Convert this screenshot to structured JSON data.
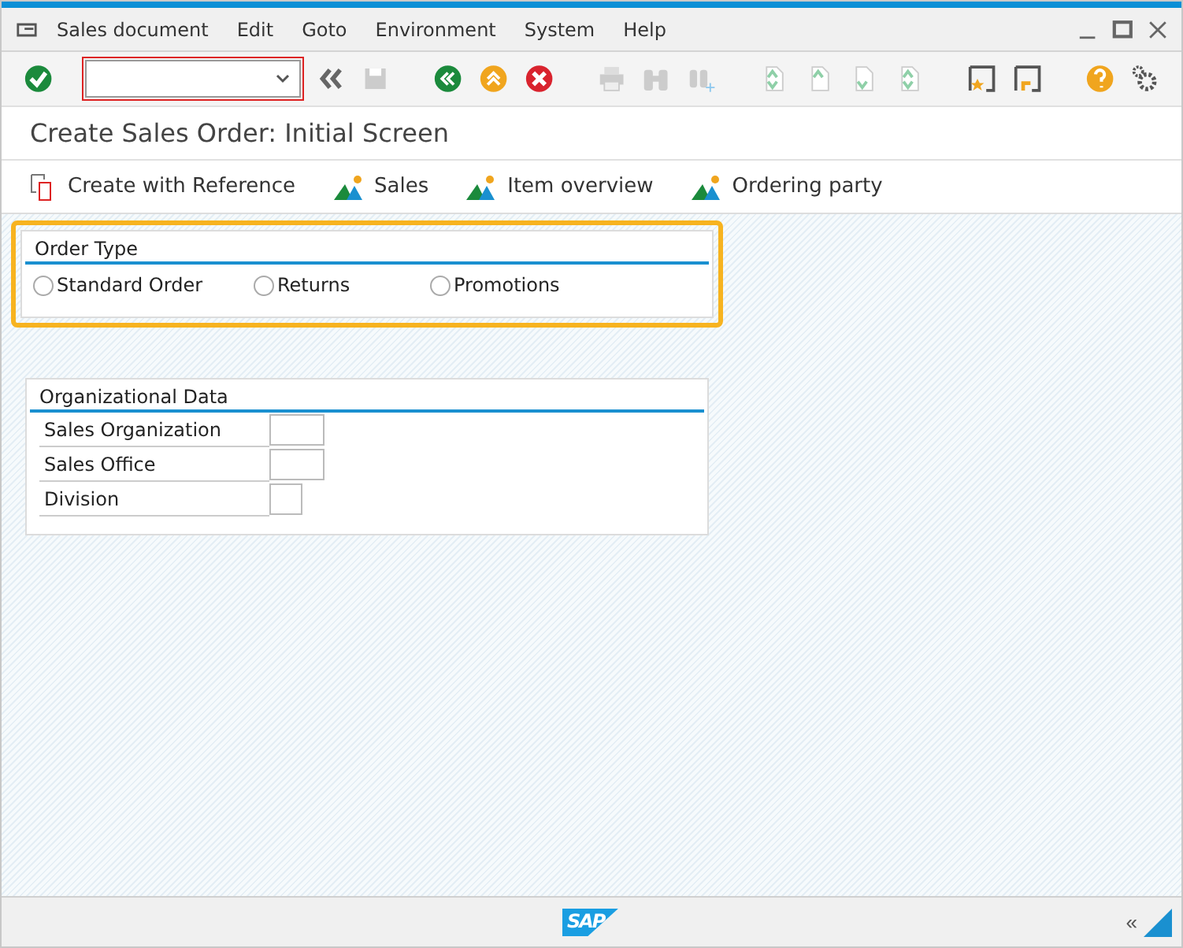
{
  "menu": [
    "Sales document",
    "Edit",
    "Goto",
    "Environment",
    "System",
    "Help"
  ],
  "title": "Create Sales Order: Initial Screen",
  "app_toolbar": [
    {
      "kind": "reference",
      "label": "Create with Reference"
    },
    {
      "kind": "mountain",
      "label": "Sales"
    },
    {
      "kind": "mountain",
      "label": "Item overview"
    },
    {
      "kind": "mountain",
      "label": "Ordering party"
    }
  ],
  "order_type": {
    "title": "Order Type",
    "highlighted": true,
    "options": [
      {
        "label": "Standard Order",
        "selected": false
      },
      {
        "label": "Returns",
        "selected": false
      },
      {
        "label": "Promotions",
        "selected": false
      }
    ]
  },
  "organizational_data": {
    "title": "Organizational Data",
    "fields": [
      {
        "label": "Sales Organization",
        "kind": "wide"
      },
      {
        "label": "Sales Office",
        "kind": "wide"
      },
      {
        "label": "Division",
        "kind": "narrow"
      }
    ]
  },
  "status_bar": {
    "logo": "SAP",
    "collapse": "«"
  }
}
